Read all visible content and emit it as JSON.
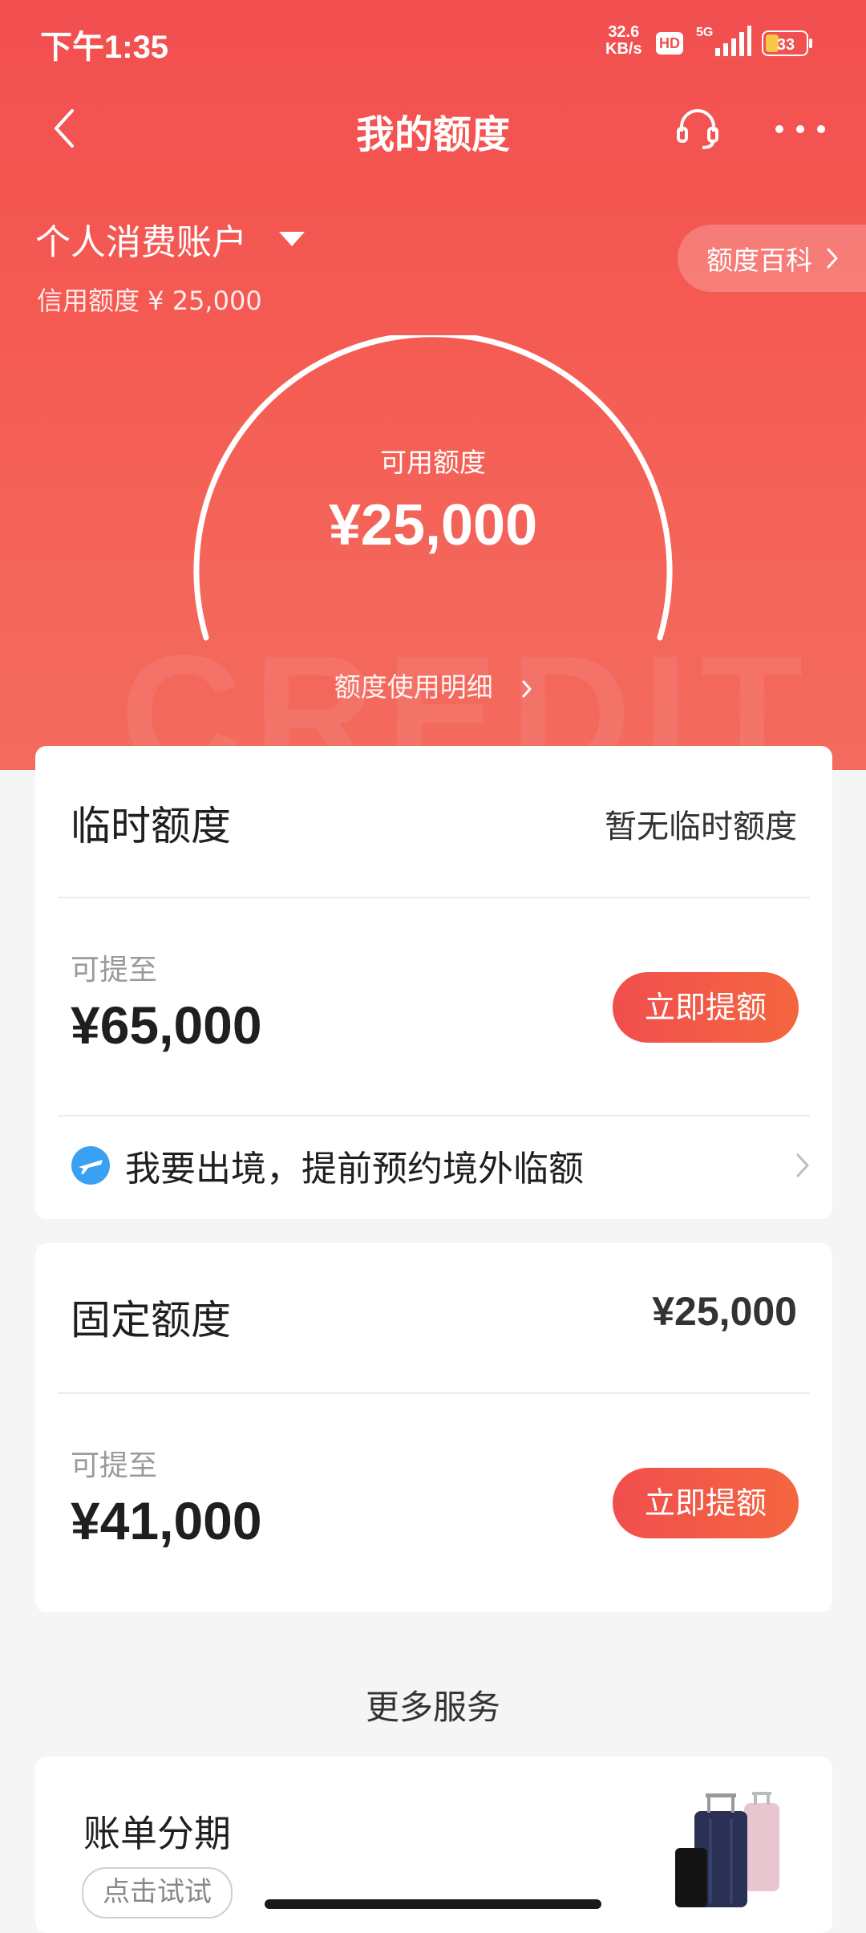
{
  "status_bar": {
    "time": "下午1:35",
    "net_speed_value": "32.6",
    "net_speed_unit": "KB/s",
    "hd_badge": "HD",
    "network": "5G",
    "battery": "33"
  },
  "nav": {
    "title": "我的额度",
    "back_icon": "chevron-left-icon",
    "service_icon": "headset-icon",
    "more_icon": "more-dots-icon"
  },
  "account": {
    "name": "个人消费账户",
    "credit_limit": "信用额度 ¥ 25,000",
    "wiki_label": "额度百科"
  },
  "gauge": {
    "label": "可用额度",
    "amount": "¥25,000",
    "detail_link": "额度使用明细",
    "used_fraction": 1.0
  },
  "temp_limit": {
    "title": "临时额度",
    "status": "暂无临时额度",
    "up_to_label": "可提至",
    "up_to_amount": "¥65,000",
    "button": "立即提额",
    "travel_text": "我要出境，提前预约境外临额"
  },
  "fixed_limit": {
    "title": "固定额度",
    "amount": "¥25,000",
    "up_to_label": "可提至",
    "up_to_amount": "¥41,000",
    "button": "立即提额"
  },
  "more_services": {
    "title": "更多服务",
    "installment_title": "账单分期",
    "try_button": "点击试试"
  },
  "colors": {
    "brand_red": "#f24f50",
    "button_gradient_end": "#f4663f",
    "page_bg": "#f5f5f5"
  },
  "watermark": "CREDIT"
}
